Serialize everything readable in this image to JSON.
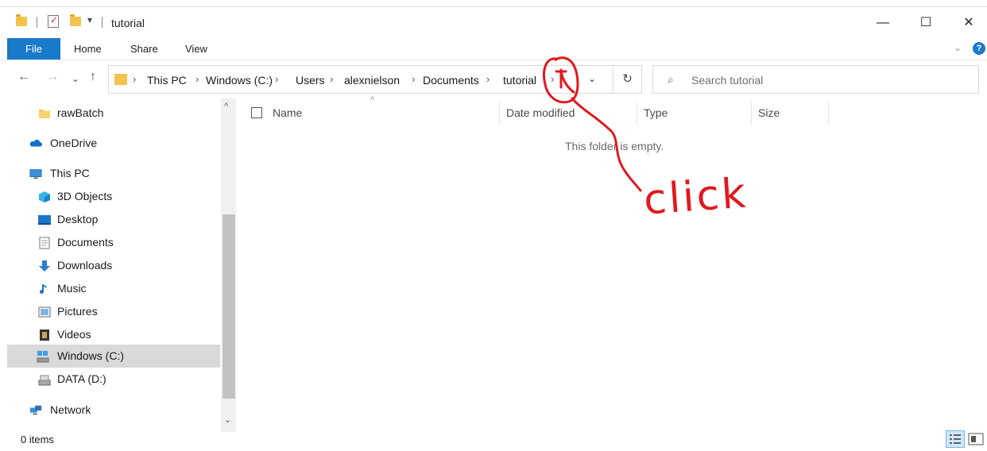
{
  "window": {
    "title": "tutorial",
    "minimize_label": "—",
    "maximize_label": "☐",
    "close_label": "✕"
  },
  "ribbon": {
    "tabs": [
      "File",
      "Home",
      "Share",
      "View"
    ],
    "help_label": "?",
    "collapse_label": "⌄"
  },
  "nav": {
    "back": "←",
    "forward": "→",
    "recent": "⌄",
    "up": "↑",
    "breadcrumbs": [
      "This PC",
      "Windows (C:)",
      "Users",
      "alexnielson",
      "Documents",
      "tutorial"
    ],
    "crumb_separator": "›",
    "dropdown": "⌄",
    "refresh": "↻"
  },
  "search": {
    "placeholder": "Search tutorial"
  },
  "sidebar": {
    "items": [
      {
        "label": "rawBatch",
        "icon": "folder-icon"
      },
      {
        "label": "OneDrive",
        "icon": "onedrive-icon"
      },
      {
        "label": "This PC",
        "icon": "computer-icon"
      },
      {
        "label": "3D Objects",
        "icon": "cube-icon"
      },
      {
        "label": "Desktop",
        "icon": "desktop-icon"
      },
      {
        "label": "Documents",
        "icon": "document-icon"
      },
      {
        "label": "Downloads",
        "icon": "download-icon"
      },
      {
        "label": "Music",
        "icon": "music-icon"
      },
      {
        "label": "Pictures",
        "icon": "pictures-icon"
      },
      {
        "label": "Videos",
        "icon": "video-icon"
      },
      {
        "label": "Windows (C:)",
        "icon": "windows-drive-icon",
        "selected": true
      },
      {
        "label": "DATA (D:)",
        "icon": "drive-icon"
      },
      {
        "label": "Network",
        "icon": "network-icon"
      }
    ]
  },
  "columns": [
    "Name",
    "Date modified",
    "Type",
    "Size"
  ],
  "content": {
    "empty_message": "This folder is empty."
  },
  "annotation": {
    "text": "click",
    "color": "#e0191f"
  },
  "status": {
    "items_count": "0 items"
  },
  "colors": {
    "accent": "#1979ca",
    "folder": "#f3c34e",
    "selected": "#d9d9d9"
  }
}
